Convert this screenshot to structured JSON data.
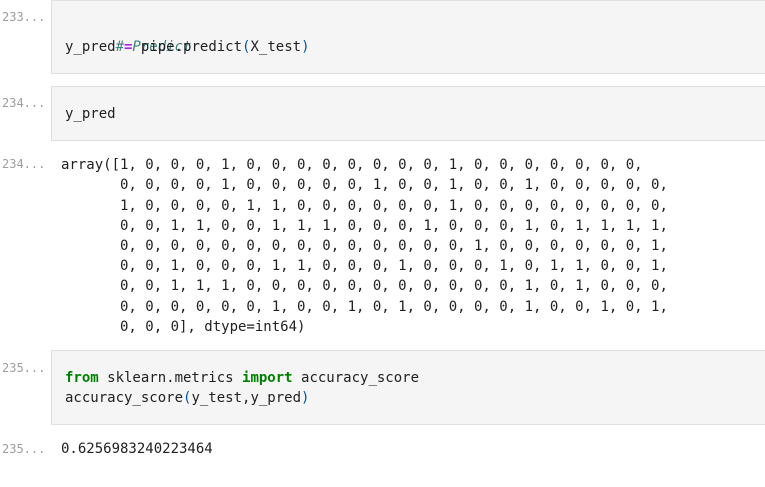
{
  "cells": [
    {
      "prompt": "233...",
      "kind": "input",
      "lines": [
        {
          "comment": "# Predict"
        },
        {
          "lhs": "y_pred",
          "op": "=",
          "rhs": "pipe.predict",
          "open": "(",
          "arg": "X_test",
          "close": ")"
        }
      ]
    },
    {
      "prompt": "234...",
      "kind": "input",
      "lines": [
        {
          "text": "y_pred"
        }
      ]
    },
    {
      "prompt": "234...",
      "kind": "output",
      "lines": [
        "array([1, 0, 0, 0, 1, 0, 0, 0, 0, 0, 0, 0, 0, 1, 0, 0, 0, 0, 0, 0, 0,",
        "       0, 0, 0, 0, 1, 0, 0, 0, 0, 0, 1, 0, 0, 1, 0, 0, 1, 0, 0, 0, 0, 0,",
        "       1, 0, 0, 0, 0, 1, 1, 0, 0, 0, 0, 0, 0, 1, 0, 0, 0, 0, 0, 0, 0, 0,",
        "       0, 0, 1, 1, 0, 0, 1, 1, 1, 0, 0, 0, 1, 0, 0, 0, 1, 0, 1, 1, 1, 1,",
        "       0, 0, 0, 0, 0, 0, 0, 0, 0, 0, 0, 0, 0, 0, 1, 0, 0, 0, 0, 0, 0, 1,",
        "       0, 0, 1, 0, 0, 0, 1, 1, 0, 0, 0, 1, 0, 0, 0, 1, 0, 1, 1, 0, 0, 1,",
        "       0, 0, 1, 1, 1, 0, 0, 0, 0, 0, 0, 0, 0, 0, 0, 0, 1, 0, 1, 0, 0, 0,",
        "       0, 0, 0, 0, 0, 0, 1, 0, 0, 1, 0, 1, 0, 0, 0, 0, 1, 0, 0, 1, 0, 1,",
        "       0, 0, 0], dtype=int64)"
      ]
    },
    {
      "prompt": "235...",
      "kind": "input",
      "lines": [
        {
          "kw1": "from",
          "module": " sklearn.metrics ",
          "kw2": "import",
          "name": " accuracy_score"
        },
        {
          "fn": "accuracy_score",
          "open": "(",
          "args": "y_test,y_pred",
          "close": ")"
        }
      ]
    },
    {
      "prompt": "235...",
      "kind": "output",
      "lines": [
        "0.6256983240223464"
      ]
    }
  ]
}
